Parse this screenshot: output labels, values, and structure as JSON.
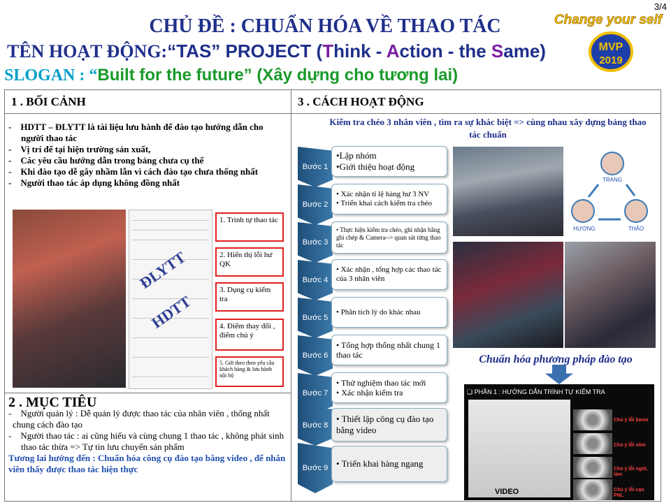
{
  "page_number": "3/4",
  "logo": {
    "line1": "Change your self",
    "line2": "MVP",
    "line3": "2019"
  },
  "topic": "CHỦ ĐỀ : CHUẨN HÓA VỀ THAO TÁC",
  "activity": {
    "label": "TÊN HOẠT ĐỘNG:",
    "name_open": "“TAS” PROJECT (",
    "t": "T",
    "hink": "hink - ",
    "a": "A",
    "ction": "ction - the ",
    "s": "S",
    "ame": "ame)"
  },
  "slogan": {
    "label": "SLOGAN : “",
    "text": "Built for the future” (Xây dựng cho tương lai)"
  },
  "section1": {
    "title": "1 . BỐI CẢNH",
    "bullets": [
      "HDTT – ĐLYTT là tài liệu lưu hành để đào tạo hướng dẫn cho người thao tác",
      "Vị trí để tại hiện trường sản xuất,",
      "Các yêu cầu hướng dẫn trong bảng chưa cụ thể",
      "Khi đào tạo dễ gây nhầm lẫn vì cách đào tạo chưa thống nhất",
      "Người thao tác áp dụng  không đồng nhất"
    ],
    "watermark1": "ĐLYTT",
    "watermark2": "HDTT",
    "callouts": [
      "1. Trình tự thao tác",
      "2. Hiển thị lỗi hư QK",
      "3. Dụng cụ kiểm tra",
      "4. Điểm thay đổi , điểm chú ý",
      "5. Gửi theo theo yêu cầu khách hàng & lưu hành nội bộ"
    ]
  },
  "section2": {
    "title": "2 . MỤC TIÊU",
    "bullets": [
      "Người quản lý : Dễ quản lý được thao tác của nhân viên , thống nhất chung cách đào tạo",
      "Người thao tác  : ai cũng hiểu và cùng chung 1 thao tác , không phát sinh thao tác thừa => Tự  tin lưu chuyển sản phẩm"
    ],
    "future": "Tương lai hướng đến : Chuẩn hóa công cụ đào tạo bằng video ,  để  nhân viên thấy được thao tác hiện thực"
  },
  "section3": {
    "title": "3 . CÁCH HOẠT ĐỘNG",
    "intro": "Kiểm tra chéo 3 nhân viên , tìm ra sự khác biệt => cùng nhau xây dựng bảng thao tác chuẩn",
    "steps": [
      {
        "label": "Bước 1",
        "lines": [
          "•Lập nhóm",
          "•Giới thiệu hoạt động"
        ]
      },
      {
        "label": "Bước 2",
        "lines": [
          "• Xác nhận tỉ lệ hàng hư 3 NV",
          "• Triển khai cách kiểm tra chéo"
        ]
      },
      {
        "label": "Bước 3",
        "lines": [
          "• Thực hiện kiểm tra chéo, ghi nhận bằng ghi chép & Camera--> quan sát từng thao tác"
        ]
      },
      {
        "label": "Bước 4",
        "lines": [
          "• Xác nhận , tổng hợp các thao tác của 3 nhân viên"
        ]
      },
      {
        "label": "Bước 5",
        "lines": [
          "• Phân tích lý do khác nhau"
        ]
      },
      {
        "label": "Bước 6",
        "lines": [
          "• Tổng hợp thống nhất chung 1 thao tác"
        ]
      },
      {
        "label": "Bước 7",
        "lines": [
          "• Thử nghiệm thao tác mới",
          "• Xác nhận kiểm  tra"
        ]
      },
      {
        "label": "Bước 8",
        "lines": [
          "• Thiết lập công cụ đào tạo bằng video"
        ]
      },
      {
        "label": "Bước 9",
        "lines": [
          "• Triển khai  hàng ngang"
        ]
      }
    ],
    "people": [
      "TRANG",
      "HƯƠNG",
      "THẢO"
    ],
    "standardize": "Chuẩn hóa phương pháp đào tạo",
    "video_header": "❑  PHẦN 1 : HƯỚNG DẪN TRÌNH TỰ KIỂM TRA",
    "video_label": "VIDEO",
    "thumb_labels": [
      "Chú ý lỗi bavia",
      "Chú ý lỗi vòm",
      "Chú ý lỗi ngót, làm",
      "Chú ý lỗi cạn PNL"
    ]
  },
  "colors": {
    "title_blue": "#1f2f8a",
    "slogan_cyan": "#00a0c8",
    "slogan_green": "#1a9a2a",
    "callout_red": "#e02020",
    "step_blue": "#1f4f7a"
  }
}
